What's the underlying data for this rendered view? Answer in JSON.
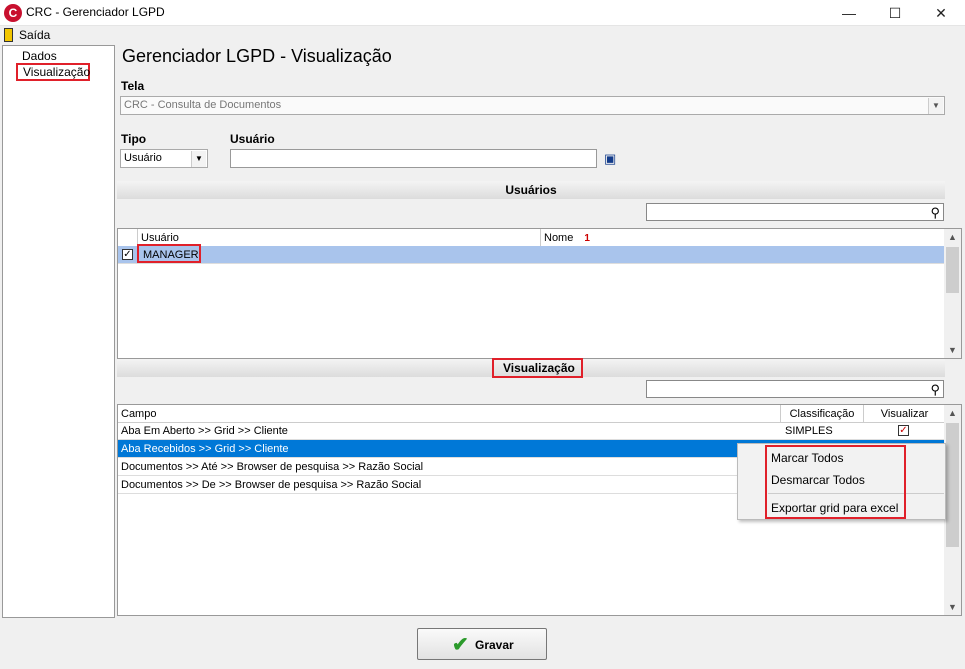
{
  "window": {
    "title": "CRC - Gerenciador LGPD",
    "app_icon": "C",
    "minimize": "—",
    "maximize": "☐",
    "close": "✕"
  },
  "menu": {
    "exit_label": "Saída"
  },
  "tree": {
    "items": [
      "Dados",
      "Visualização"
    ]
  },
  "page_title": "Gerenciador LGPD - Visualização",
  "tela": {
    "label": "Tela",
    "value": "CRC - Consulta de Documentos"
  },
  "tipo": {
    "label": "Tipo",
    "value": "Usuário"
  },
  "usuario_field": {
    "label": "Usuário",
    "value": ""
  },
  "users_section": {
    "title": "Usuários",
    "columns": [
      "Usuário",
      "Nome"
    ],
    "sort_indicator": "1",
    "rows": [
      {
        "usuario": "MANAGER",
        "nome": "",
        "checked": true
      }
    ]
  },
  "visualization_section": {
    "title": "Visualização",
    "columns": [
      "Campo",
      "Classificação",
      "Visualizar"
    ],
    "rows": [
      {
        "campo": "Aba Em Aberto >> Grid >>  Cliente",
        "classificacao": "SIMPLES",
        "visualizar": true
      },
      {
        "campo": "Aba Recebidos >> Grid >> Cliente",
        "classificacao": "",
        "visualizar": false
      },
      {
        "campo": "Documentos >> Até >> Browser de pesquisa >> Razão Social",
        "classificacao": "",
        "visualizar": false
      },
      {
        "campo": "Documentos >> De >> Browser de pesquisa >> Razão Social",
        "classificacao": "",
        "visualizar": false
      }
    ]
  },
  "context_menu": {
    "items": [
      "Marcar Todos",
      "Desmarcar Todos",
      "Exportar grid para excel"
    ]
  },
  "save_button": {
    "label": "Gravar"
  },
  "colors": {
    "selection": "#0078d7",
    "highlight_box": "#e0202a",
    "accent_green": "#2b9a2b"
  }
}
